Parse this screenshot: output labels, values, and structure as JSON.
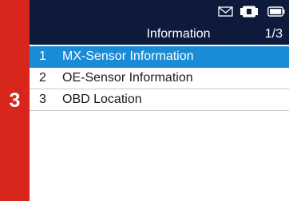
{
  "step": {
    "number": "3",
    "color": "#d9261c"
  },
  "status_bar": {
    "icons": [
      "mail-icon",
      "vci-connector-icon",
      "battery-icon"
    ]
  },
  "header": {
    "title": "Information",
    "page_indicator": "1/3"
  },
  "menu": {
    "selected_index": 0,
    "items": [
      {
        "number": "1",
        "label": "MX-Sensor Information"
      },
      {
        "number": "2",
        "label": "OE-Sensor Information"
      },
      {
        "number": "3",
        "label": "OBD Location"
      }
    ]
  },
  "colors": {
    "header_bg": "#0d1a3c",
    "highlight": "#1a8bd6",
    "step_bar": "#d9261c"
  }
}
